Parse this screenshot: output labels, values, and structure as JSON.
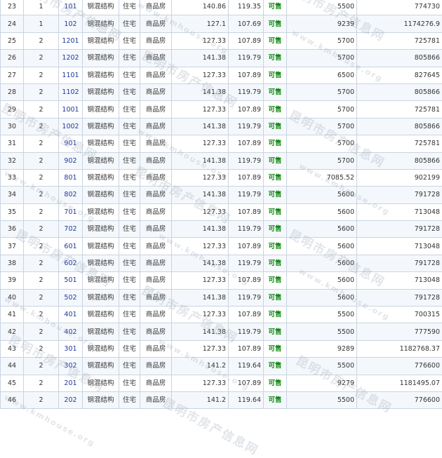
{
  "watermark": {
    "text": "昆明市房产信息网",
    "url": "www.kmhouse.org"
  },
  "rows": [
    {
      "no": "23",
      "bldg": "1",
      "room": "101",
      "structure": "钢混结构",
      "use": "住宅",
      "type": "商品房",
      "area1": "140.86",
      "area2": "119.35",
      "status": "可售",
      "price": "5500",
      "total": "774730"
    },
    {
      "no": "24",
      "bldg": "1",
      "room": "102",
      "structure": "钢混结构",
      "use": "住宅",
      "type": "商品房",
      "area1": "127.1",
      "area2": "107.69",
      "status": "可售",
      "price": "9239",
      "total": "1174276.9"
    },
    {
      "no": "25",
      "bldg": "2",
      "room": "1201",
      "structure": "钢混结构",
      "use": "住宅",
      "type": "商品房",
      "area1": "127.33",
      "area2": "107.89",
      "status": "可售",
      "price": "5700",
      "total": "725781"
    },
    {
      "no": "26",
      "bldg": "2",
      "room": "1202",
      "structure": "钢混结构",
      "use": "住宅",
      "type": "商品房",
      "area1": "141.38",
      "area2": "119.79",
      "status": "可售",
      "price": "5700",
      "total": "805866"
    },
    {
      "no": "27",
      "bldg": "2",
      "room": "1101",
      "structure": "钢混结构",
      "use": "住宅",
      "type": "商品房",
      "area1": "127.33",
      "area2": "107.89",
      "status": "可售",
      "price": "6500",
      "total": "827645"
    },
    {
      "no": "28",
      "bldg": "2",
      "room": "1102",
      "structure": "钢混结构",
      "use": "住宅",
      "type": "商品房",
      "area1": "141.38",
      "area2": "119.79",
      "status": "可售",
      "price": "5700",
      "total": "805866"
    },
    {
      "no": "29",
      "bldg": "2",
      "room": "1001",
      "structure": "钢混结构",
      "use": "住宅",
      "type": "商品房",
      "area1": "127.33",
      "area2": "107.89",
      "status": "可售",
      "price": "5700",
      "total": "725781"
    },
    {
      "no": "30",
      "bldg": "2",
      "room": "1002",
      "structure": "钢混结构",
      "use": "住宅",
      "type": "商品房",
      "area1": "141.38",
      "area2": "119.79",
      "status": "可售",
      "price": "5700",
      "total": "805866"
    },
    {
      "no": "31",
      "bldg": "2",
      "room": "901",
      "structure": "钢混结构",
      "use": "住宅",
      "type": "商品房",
      "area1": "127.33",
      "area2": "107.89",
      "status": "可售",
      "price": "5700",
      "total": "725781"
    },
    {
      "no": "32",
      "bldg": "2",
      "room": "902",
      "structure": "钢混结构",
      "use": "住宅",
      "type": "商品房",
      "area1": "141.38",
      "area2": "119.79",
      "status": "可售",
      "price": "5700",
      "total": "805866"
    },
    {
      "no": "33",
      "bldg": "2",
      "room": "801",
      "structure": "钢混结构",
      "use": "住宅",
      "type": "商品房",
      "area1": "127.33",
      "area2": "107.89",
      "status": "可售",
      "price": "7085.52",
      "total": "902199"
    },
    {
      "no": "34",
      "bldg": "2",
      "room": "802",
      "structure": "钢混结构",
      "use": "住宅",
      "type": "商品房",
      "area1": "141.38",
      "area2": "119.79",
      "status": "可售",
      "price": "5600",
      "total": "791728"
    },
    {
      "no": "35",
      "bldg": "2",
      "room": "701",
      "structure": "钢混结构",
      "use": "住宅",
      "type": "商品房",
      "area1": "127.33",
      "area2": "107.89",
      "status": "可售",
      "price": "5600",
      "total": "713048"
    },
    {
      "no": "36",
      "bldg": "2",
      "room": "702",
      "structure": "钢混结构",
      "use": "住宅",
      "type": "商品房",
      "area1": "141.38",
      "area2": "119.79",
      "status": "可售",
      "price": "5600",
      "total": "791728"
    },
    {
      "no": "37",
      "bldg": "2",
      "room": "601",
      "structure": "钢混结构",
      "use": "住宅",
      "type": "商品房",
      "area1": "127.33",
      "area2": "107.89",
      "status": "可售",
      "price": "5600",
      "total": "713048"
    },
    {
      "no": "38",
      "bldg": "2",
      "room": "602",
      "structure": "钢混结构",
      "use": "住宅",
      "type": "商品房",
      "area1": "141.38",
      "area2": "119.79",
      "status": "可售",
      "price": "5600",
      "total": "791728"
    },
    {
      "no": "39",
      "bldg": "2",
      "room": "501",
      "structure": "钢混结构",
      "use": "住宅",
      "type": "商品房",
      "area1": "127.33",
      "area2": "107.89",
      "status": "可售",
      "price": "5600",
      "total": "713048"
    },
    {
      "no": "40",
      "bldg": "2",
      "room": "502",
      "structure": "钢混结构",
      "use": "住宅",
      "type": "商品房",
      "area1": "141.38",
      "area2": "119.79",
      "status": "可售",
      "price": "5600",
      "total": "791728"
    },
    {
      "no": "41",
      "bldg": "2",
      "room": "401",
      "structure": "钢混结构",
      "use": "住宅",
      "type": "商品房",
      "area1": "127.33",
      "area2": "107.89",
      "status": "可售",
      "price": "5500",
      "total": "700315"
    },
    {
      "no": "42",
      "bldg": "2",
      "room": "402",
      "structure": "钢混结构",
      "use": "住宅",
      "type": "商品房",
      "area1": "141.38",
      "area2": "119.79",
      "status": "可售",
      "price": "5500",
      "total": "777590"
    },
    {
      "no": "43",
      "bldg": "2",
      "room": "301",
      "structure": "钢混结构",
      "use": "住宅",
      "type": "商品房",
      "area1": "127.33",
      "area2": "107.89",
      "status": "可售",
      "price": "9289",
      "total": "1182768.37"
    },
    {
      "no": "44",
      "bldg": "2",
      "room": "302",
      "structure": "钢混结构",
      "use": "住宅",
      "type": "商品房",
      "area1": "141.2",
      "area2": "119.64",
      "status": "可售",
      "price": "5500",
      "total": "776600"
    },
    {
      "no": "45",
      "bldg": "2",
      "room": "201",
      "structure": "钢混结构",
      "use": "住宅",
      "type": "商品房",
      "area1": "127.33",
      "area2": "107.89",
      "status": "可售",
      "price": "9279",
      "total": "1181495.07"
    },
    {
      "no": "46",
      "bldg": "2",
      "room": "202",
      "structure": "钢混结构",
      "use": "住宅",
      "type": "商品房",
      "area1": "141.2",
      "area2": "119.64",
      "status": "可售",
      "price": "5500",
      "total": "776600"
    }
  ]
}
